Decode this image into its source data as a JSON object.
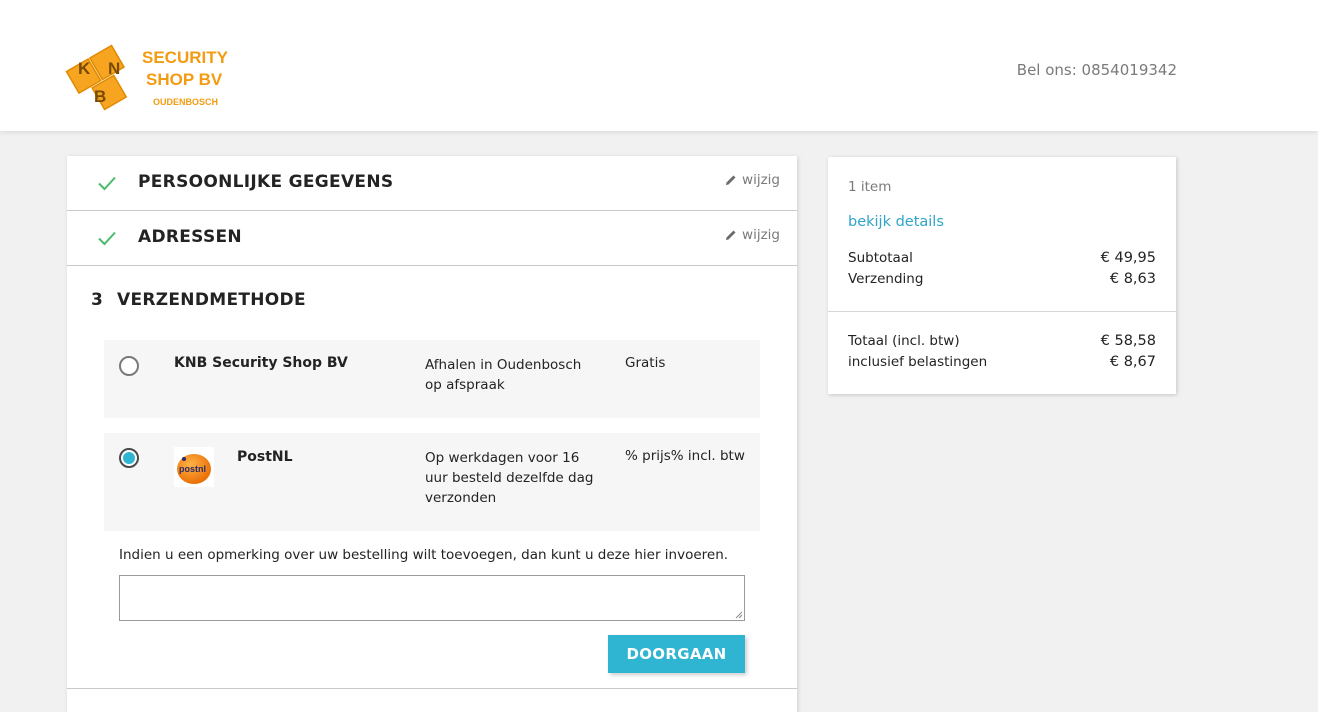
{
  "header": {
    "logo": {
      "line1": "SECURITY",
      "line2": "SHOP BV",
      "line3": "OUDENBOSCH",
      "emblem_letters": [
        "K",
        "N",
        "B"
      ]
    },
    "phone": "Bel ons: 0854019342"
  },
  "checkout": {
    "steps": [
      {
        "title": "PERSOONLIJKE GEGEVENS",
        "edit_label": "wijzig",
        "icon": "check-icon"
      },
      {
        "title": "ADRESSEN",
        "edit_label": "wijzig",
        "icon": "check-icon"
      }
    ],
    "current_step": {
      "number": "3",
      "title": "VERZENDMETHODE",
      "options": [
        {
          "name": "KNB Security Shop BV",
          "delay": "Afhalen in Oudenbosch op afspraak",
          "price": "Gratis",
          "selected": false
        },
        {
          "name": "PostNL",
          "delay": "Op werkdagen voor 16 uur besteld dezelfde dag verzonden",
          "price": "% prijs% incl. btw",
          "selected": true,
          "logo_text": "postnl"
        }
      ],
      "comment_label": "Indien u een opmerking over uw bestelling wilt toevoegen, dan kunt u deze hier invoeren.",
      "comment_value": "",
      "continue_label": "DOORGAAN"
    }
  },
  "summary": {
    "items_count": "1 item",
    "details_link": "bekijk details",
    "subtotal_label": "Subtotaal",
    "subtotal_value": "€ 49,95",
    "shipping_label": "Verzending",
    "shipping_value": "€ 8,63",
    "total_label": "Totaal (incl. btw)",
    "total_value": "€ 58,58",
    "tax_label": "inclusief belastingen",
    "tax_value": "€ 8,67"
  },
  "colors": {
    "accent": "#2fb5d2",
    "link": "#2fa5c8",
    "check": "#4cbb6c",
    "logo_orange": "#f39c12"
  }
}
